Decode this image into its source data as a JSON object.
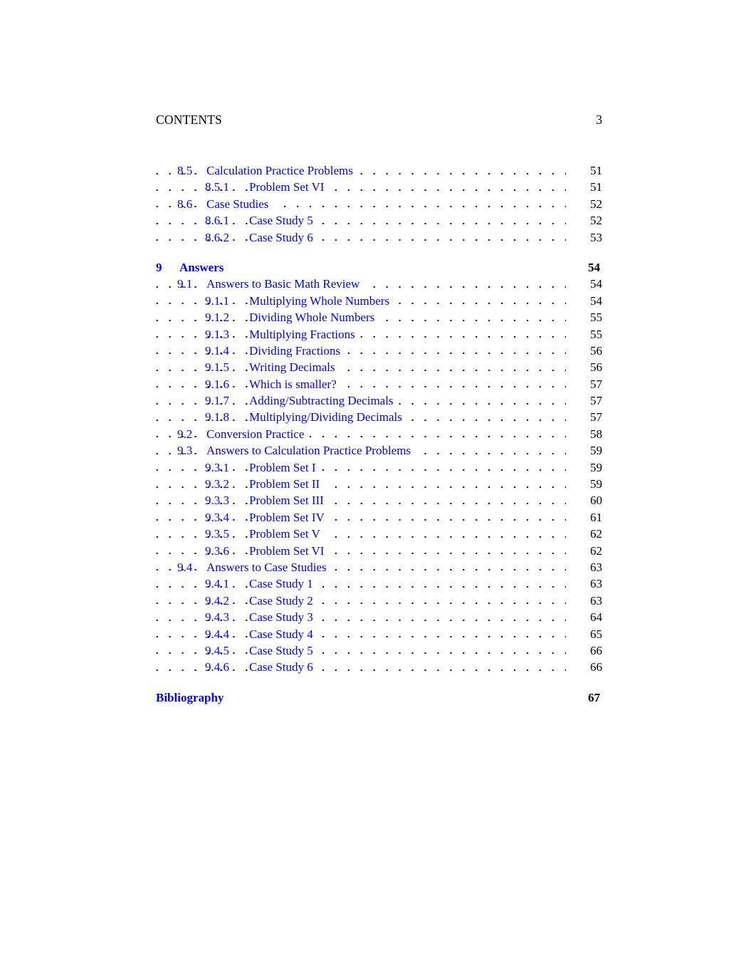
{
  "header": {
    "title": "CONTENTS",
    "folio": "3"
  },
  "toc": {
    "entries": [
      {
        "level": 2,
        "number": "8.5",
        "title": "Calculation Practice Problems",
        "page": "51",
        "gap": ""
      },
      {
        "level": 3,
        "number": "8.5.1",
        "title": "Problem Set VI",
        "page": "51",
        "gap": ""
      },
      {
        "level": 2,
        "number": "8.6",
        "title": "Case Studies",
        "page": "52",
        "gap": ""
      },
      {
        "level": 3,
        "number": "8.6.1",
        "title": "Case Study 5",
        "page": "52",
        "gap": ""
      },
      {
        "level": 3,
        "number": "8.6.2",
        "title": "Case Study 6",
        "page": "53",
        "gap": ""
      },
      {
        "level": 1,
        "number": "9",
        "title": "Answers",
        "page": "54",
        "gap": "gap-chapter"
      },
      {
        "level": 2,
        "number": "9.1",
        "title": "Answers to Basic Math Review",
        "page": "54",
        "gap": ""
      },
      {
        "level": 3,
        "number": "9.1.1",
        "title": "Multiplying Whole Numbers",
        "page": "54",
        "gap": ""
      },
      {
        "level": 3,
        "number": "9.1.2",
        "title": "Dividing Whole Numbers",
        "page": "55",
        "gap": ""
      },
      {
        "level": 3,
        "number": "9.1.3",
        "title": "Multiplying Fractions",
        "page": "55",
        "gap": ""
      },
      {
        "level": 3,
        "number": "9.1.4",
        "title": "Dividing Fractions",
        "page": "56",
        "gap": ""
      },
      {
        "level": 3,
        "number": "9.1.5",
        "title": "Writing Decimals",
        "page": "56",
        "gap": ""
      },
      {
        "level": 3,
        "number": "9.1.6",
        "title": "Which is smaller?",
        "page": "57",
        "gap": ""
      },
      {
        "level": 3,
        "number": "9.1.7",
        "title": "Adding/Subtracting Decimals",
        "page": "57",
        "gap": ""
      },
      {
        "level": 3,
        "number": "9.1.8",
        "title": "Multiplying/Dividing Decimals",
        "page": "57",
        "gap": ""
      },
      {
        "level": 2,
        "number": "9.2",
        "title": "Conversion Practice",
        "page": "58",
        "gap": ""
      },
      {
        "level": 2,
        "number": "9.3",
        "title": "Answers to Calculation Practice Problems",
        "page": "59",
        "gap": ""
      },
      {
        "level": 3,
        "number": "9.3.1",
        "title": "Problem Set I",
        "page": "59",
        "gap": ""
      },
      {
        "level": 3,
        "number": "9.3.2",
        "title": "Problem Set II",
        "page": "59",
        "gap": ""
      },
      {
        "level": 3,
        "number": "9.3.3",
        "title": "Problem Set III",
        "page": "60",
        "gap": ""
      },
      {
        "level": 3,
        "number": "9.3.4",
        "title": "Problem Set IV",
        "page": "61",
        "gap": ""
      },
      {
        "level": 3,
        "number": "9.3.5",
        "title": "Problem Set V",
        "page": "62",
        "gap": ""
      },
      {
        "level": 3,
        "number": "9.3.6",
        "title": "Problem Set VI",
        "page": "62",
        "gap": ""
      },
      {
        "level": 2,
        "number": "9.4",
        "title": "Answers to Case Studies",
        "page": "63",
        "gap": ""
      },
      {
        "level": 3,
        "number": "9.4.1",
        "title": "Case Study 1",
        "page": "63",
        "gap": ""
      },
      {
        "level": 3,
        "number": "9.4.2",
        "title": "Case Study 2",
        "page": "63",
        "gap": ""
      },
      {
        "level": 3,
        "number": "9.4.3",
        "title": "Case Study 3",
        "page": "64",
        "gap": ""
      },
      {
        "level": 3,
        "number": "9.4.4",
        "title": "Case Study 4",
        "page": "65",
        "gap": ""
      },
      {
        "level": 3,
        "number": "9.4.5",
        "title": "Case Study 5",
        "page": "66",
        "gap": ""
      },
      {
        "level": 3,
        "number": "9.4.6",
        "title": "Case Study 6",
        "page": "66",
        "gap": ""
      },
      {
        "level": 1,
        "number": "",
        "title": "Bibliography",
        "page": "67",
        "gap": "gap-bib"
      }
    ]
  },
  "colors": {
    "link_blue": "#0000ff",
    "text_black": "#000000",
    "page_background": "#ffffff"
  }
}
